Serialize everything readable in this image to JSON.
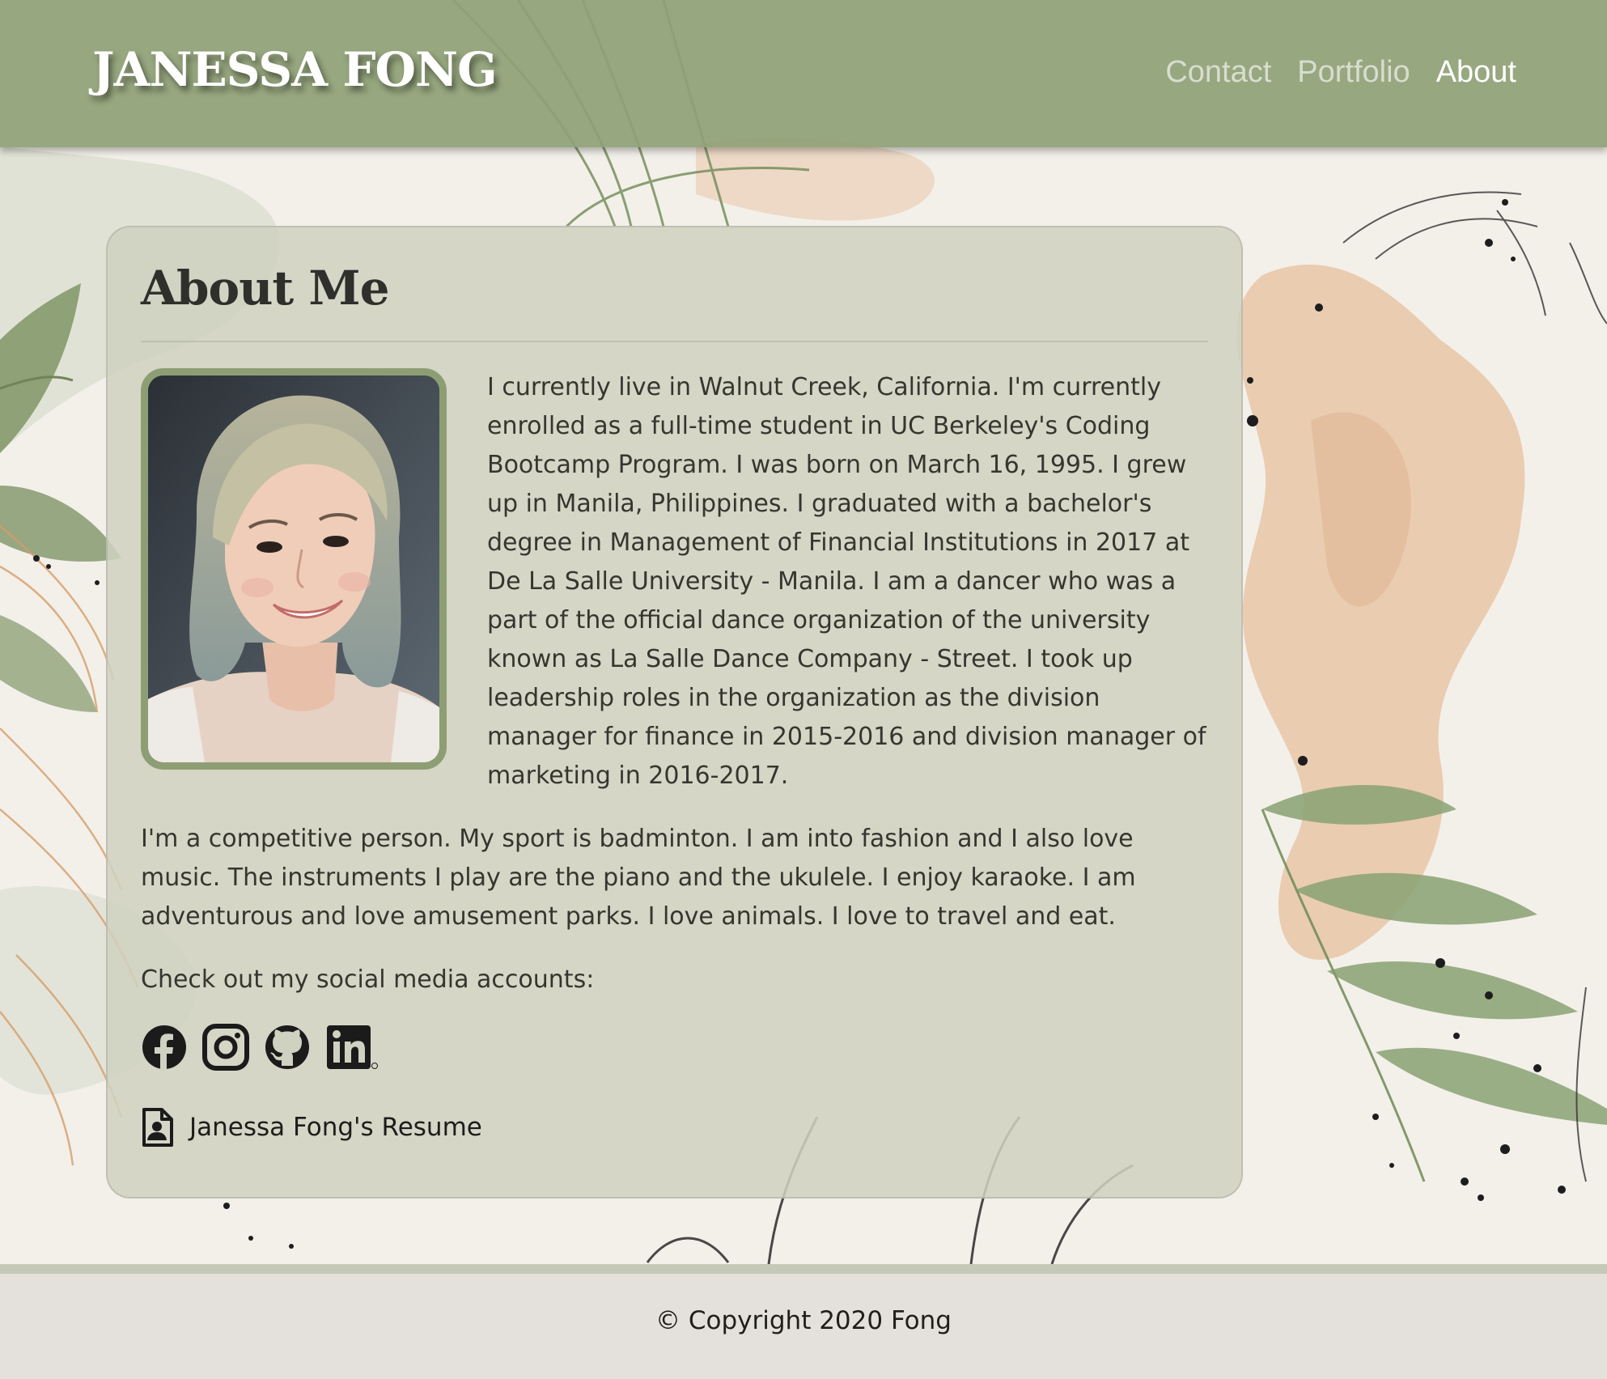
{
  "header": {
    "brand": "JANESSA FONG",
    "nav": [
      "Contact",
      "Portfolio",
      "About"
    ],
    "active_nav": "About"
  },
  "about": {
    "title": "About Me",
    "photo_alt": "Portrait photo",
    "bio1": "I currently live in Walnut Creek, California. I'm currently enrolled as a full-time student in UC Berkeley's Coding Bootcamp Program. I was born on March 16, 1995. I grew up in Manila, Philippines. I graduated with a bachelor's degree in Management of Financial Institutions in 2017 at De La Salle University - Manila. I am a dancer who was a part of the official dance organization of the university known as La Salle Dance Company - Street. I took up leadership roles in the organization as the division manager for finance in 2015-2016 and division manager of marketing in 2016-2017.",
    "bio2": "I'm a competitive person. My sport is badminton. I am into fashion and I also love music. The instruments I play are the piano and the ukulele. I enjoy karaoke. I am adventurous and love amusement parks. I love animals. I love to travel and eat.",
    "social_heading": "Check out my social media accounts:",
    "social_icons": [
      "facebook-icon",
      "instagram-icon",
      "github-icon",
      "linkedin-icon"
    ],
    "resume_label": "Janessa Fong's Resume"
  },
  "footer": {
    "copyright": "© Copyright 2020 Fong"
  },
  "colors": {
    "header_bg": "#8fa175",
    "card_bg": "#cfd2c0",
    "photo_border": "#8e9e74",
    "footer_bg": "#e4e1dc"
  }
}
